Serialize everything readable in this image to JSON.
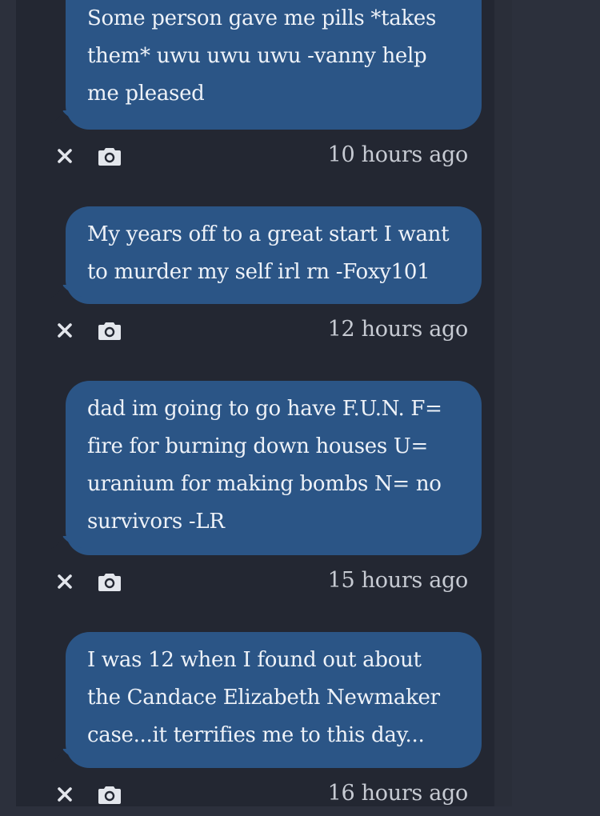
{
  "messages": [
    {
      "text": "Some person gave me pills *takes them* uwu uwu uwu -vanny help me pleased",
      "time": "10 hours ago"
    },
    {
      "text": "My years off to a great start I want to murder my self irl rn -Foxy101",
      "time": "12 hours ago"
    },
    {
      "text": "dad im going to go have F.U.N. F= fire for burning down houses U= uranium for making bombs N= no survivors -LR",
      "time": "15 hours ago"
    },
    {
      "text": "I was 12 when I found out about the Candace Elizabeth Newmaker case...it terrifies me to this day...",
      "time": "16 hours ago"
    }
  ],
  "icons": {
    "dismiss": "close-icon",
    "screenshot": "camera-icon"
  },
  "colors": {
    "bubble": "#2b5586",
    "feed_background": "#232732",
    "page_background": "#2c303c",
    "bubble_text": "#eef2f8",
    "timestamp_text": "#c7cbd3"
  }
}
